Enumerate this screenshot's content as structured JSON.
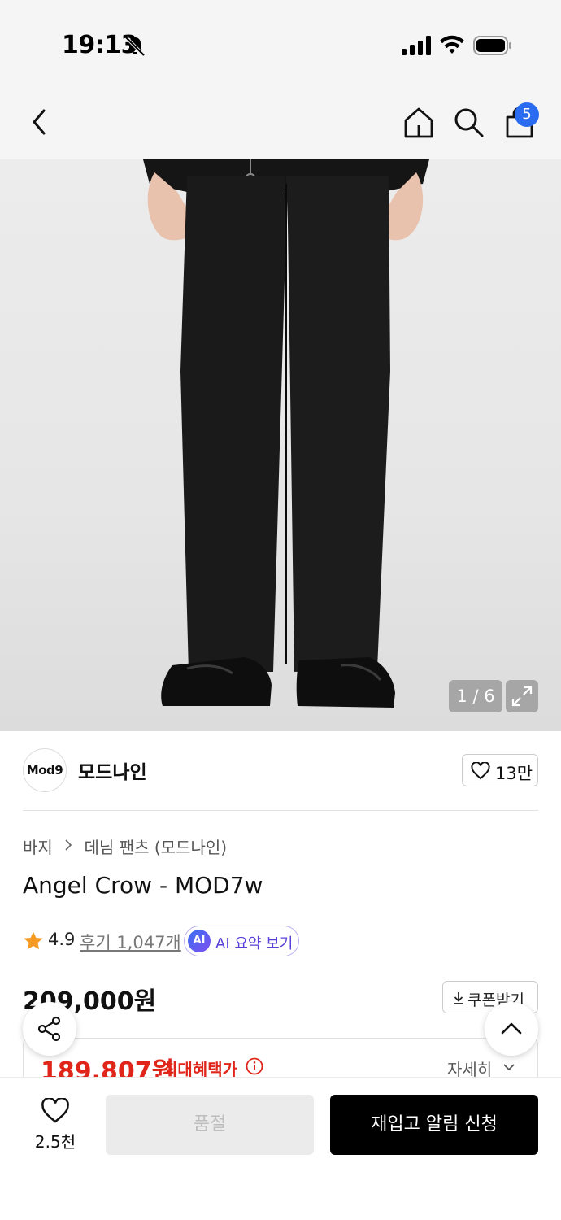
{
  "status_bar": {
    "time": "19:13",
    "icons": [
      "bell-slash-icon",
      "cellular-signal-icon",
      "wifi-icon",
      "battery-icon"
    ]
  },
  "nav": {
    "icons": [
      "back-icon",
      "home-icon",
      "search-icon",
      "shopping-bag-icon"
    ],
    "cart_count": "5"
  },
  "gallery": {
    "counter": "1 / 6",
    "icons": [
      "expand-icon"
    ]
  },
  "brand": {
    "logo_text": "Mod9",
    "name": "모드나인",
    "like_count": "13만"
  },
  "breadcrumb": [
    "바지",
    "데님 팬츠 (모드나인)"
  ],
  "product": {
    "title": "Angel Crow - MOD7w",
    "rating": "4.9",
    "review_link": "후기 1,047개",
    "ai_badge": "AI",
    "ai_summary_label": "AI 요약 보기"
  },
  "price": {
    "original": "209,000원",
    "coupon_label": "쿠폰받기",
    "max_benefit_price": "189,807원",
    "max_benefit_label": "최대혜택가",
    "detail_label": "자세히"
  },
  "bottom_bar": {
    "wish_count": "2.5천",
    "soldout_label": "품절",
    "restock_label": "재입고 알림 신청"
  },
  "colors": {
    "accent_red": "#e0261b",
    "badge_blue": "#2a6cf0",
    "star_orange": "#f59a23",
    "ai_purple": "#5a3fd8"
  }
}
